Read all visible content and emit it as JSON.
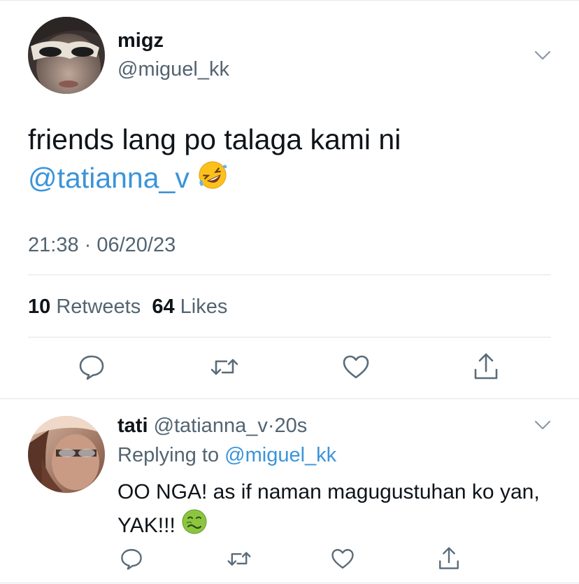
{
  "main_tweet": {
    "display_name": "migz",
    "handle": "@miguel_kk",
    "text": "friends lang po talaga kami ni",
    "mention": "@tatianna_v",
    "emoji": "rolling-on-floor-laughing",
    "timestamp": "21:38 · 06/20/23",
    "retweets_count": "10",
    "retweets_label": "Retweets",
    "likes_count": "64",
    "likes_label": "Likes"
  },
  "reply": {
    "display_name": "tati",
    "handle": "@tatianna_v",
    "separator": "·",
    "time": "20s",
    "replying_to_label": "Replying to",
    "replying_to_handle": "@miguel_kk",
    "text": "OO NGA! as if naman magugustuhan ko yan, YAK!!!",
    "emoji": "nauseated-face"
  },
  "icons": {
    "reply": "comment-bubble-icon",
    "retweet": "retweet-icon",
    "like": "heart-icon",
    "share": "share-icon",
    "menu": "chevron-down-icon"
  },
  "colors": {
    "link": "#3b94d9",
    "secondary_text": "#536471",
    "primary_text": "#0f1419",
    "divider": "#dfe3e7"
  }
}
